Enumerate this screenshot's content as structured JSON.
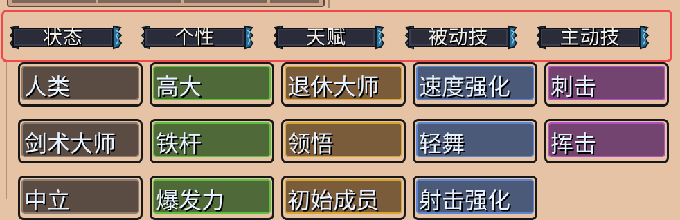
{
  "tabs": [
    {
      "label": "状态"
    },
    {
      "label": "个性"
    },
    {
      "label": "天赋"
    },
    {
      "label": "被动技"
    },
    {
      "label": "主动技"
    }
  ],
  "traits": [
    {
      "label": "人类",
      "color": "brown"
    },
    {
      "label": "高大",
      "color": "green"
    },
    {
      "label": "退休大师",
      "color": "orange"
    },
    {
      "label": "速度强化",
      "color": "blue"
    },
    {
      "label": "刺击",
      "color": "purple"
    },
    {
      "label": "剑术大师",
      "color": "brown"
    },
    {
      "label": "铁杆",
      "color": "green"
    },
    {
      "label": "领悟",
      "color": "orange"
    },
    {
      "label": "轻舞",
      "color": "blue"
    },
    {
      "label": "挥击",
      "color": "purple"
    },
    {
      "label": "中立",
      "color": "brown"
    },
    {
      "label": "爆发力",
      "color": "green"
    },
    {
      "label": "初始成员",
      "color": "orange"
    },
    {
      "label": "射击强化",
      "color": "blue"
    }
  ],
  "palette": {
    "brown": {
      "face": "#5a4c43",
      "border": "#8d7b6e"
    },
    "green": {
      "face": "#4f6a38",
      "border": "#57c23a"
    },
    "orange": {
      "face": "#7a5b3a",
      "border": "#d6a431"
    },
    "blue": {
      "face": "#4b5a78",
      "border": "#5b86d6"
    },
    "purple": {
      "face": "#734470",
      "border": "#b54fc8"
    }
  }
}
